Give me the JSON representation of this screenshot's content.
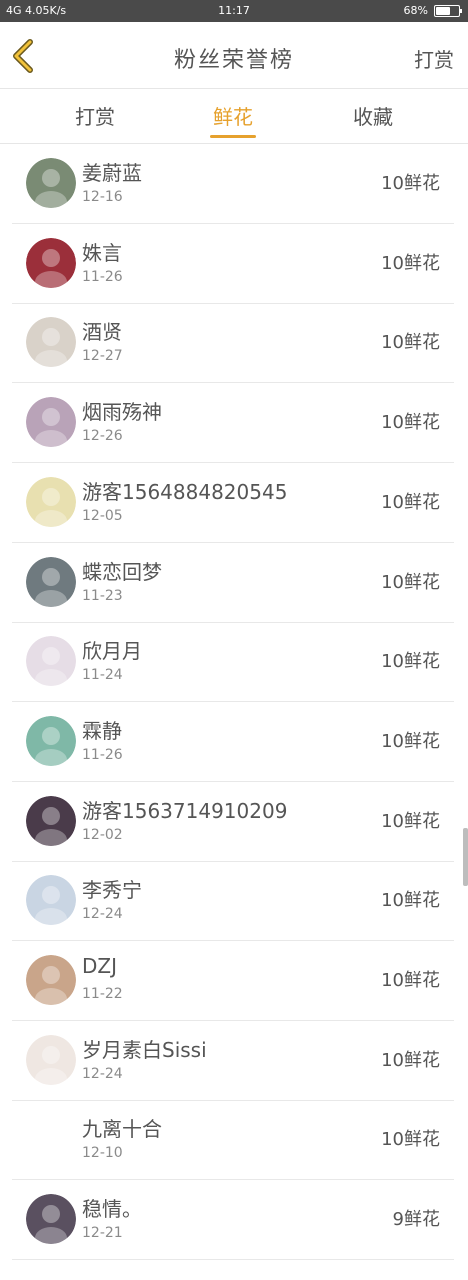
{
  "status_bar": {
    "left": "4G 4.05K/s",
    "time": "11:17",
    "battery": "68%",
    "battery_level": 0.68
  },
  "header": {
    "title": "粉丝荣誉榜",
    "action": "打赏"
  },
  "tabs": [
    {
      "label": "打赏",
      "active": false
    },
    {
      "label": "鲜花",
      "active": true
    },
    {
      "label": "收藏",
      "active": false
    }
  ],
  "fans": [
    {
      "name": "姜蔚蓝",
      "date": "12-16",
      "gift": "10鲜花",
      "avatar_color": "#7a8b74"
    },
    {
      "name": "姝言",
      "date": "11-26",
      "gift": "10鲜花",
      "avatar_color": "#9b2f3a"
    },
    {
      "name": "酒贤",
      "date": "12-27",
      "gift": "10鲜花",
      "avatar_color": "#d9d2c9"
    },
    {
      "name": "烟雨殇神",
      "date": "12-26",
      "gift": "10鲜花",
      "avatar_color": "#b9a3b8"
    },
    {
      "name": "游客1564884820545",
      "date": "12-05",
      "gift": "10鲜花",
      "avatar_color": "#e8e0b0"
    },
    {
      "name": "蝶恋回梦",
      "date": "11-23",
      "gift": "10鲜花",
      "avatar_color": "#6f7a7f"
    },
    {
      "name": "欣月月",
      "date": "11-24",
      "gift": "10鲜花",
      "avatar_color": "#e6dde6"
    },
    {
      "name": "霖静",
      "date": "11-26",
      "gift": "10鲜花",
      "avatar_color": "#7fb8a7"
    },
    {
      "name": "游客1563714910209",
      "date": "12-02",
      "gift": "10鲜花",
      "avatar_color": "#4a3b4a"
    },
    {
      "name": "李秀宁",
      "date": "12-24",
      "gift": "10鲜花",
      "avatar_color": "#c9d5e3"
    },
    {
      "name": "DZJ",
      "date": "11-22",
      "gift": "10鲜花",
      "avatar_color": "#c9a58a"
    },
    {
      "name": "岁月素白Sissi",
      "date": "12-24",
      "gift": "10鲜花",
      "avatar_color": "#efe7e2"
    },
    {
      "name": "九离十合",
      "date": "12-10",
      "gift": "10鲜花",
      "avatar_color": "#ffffff"
    },
    {
      "name": "稳情。",
      "date": "12-21",
      "gift": "9鲜花",
      "avatar_color": "#5a5060"
    }
  ]
}
